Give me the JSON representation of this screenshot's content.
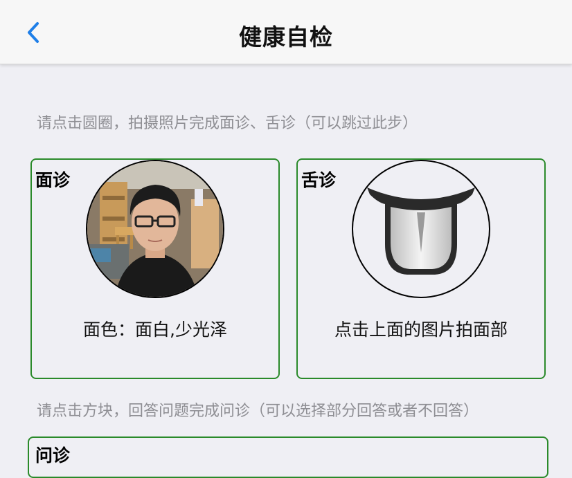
{
  "navbar": {
    "title": "健康自检",
    "back_icon": "chevron-left-icon",
    "accent_color": "#1f7fe8"
  },
  "hints": {
    "photo": "请点击圆圈，拍摄照片完成面诊、舌诊（可以跳过此步）",
    "questions": "请点击方块，回答问题完成问诊（可以选择部分回答或者不回答）"
  },
  "face_card": {
    "label": "面诊",
    "result": "面色：面白,少光泽",
    "image": "face-photo"
  },
  "tongue_card": {
    "label": "舌诊",
    "prompt": "点击上面的图片拍面部",
    "image": "tongue-icon"
  },
  "ask_card": {
    "label": "问诊"
  },
  "colors": {
    "card_border": "#2a8a2a",
    "background": "#efeff4"
  }
}
